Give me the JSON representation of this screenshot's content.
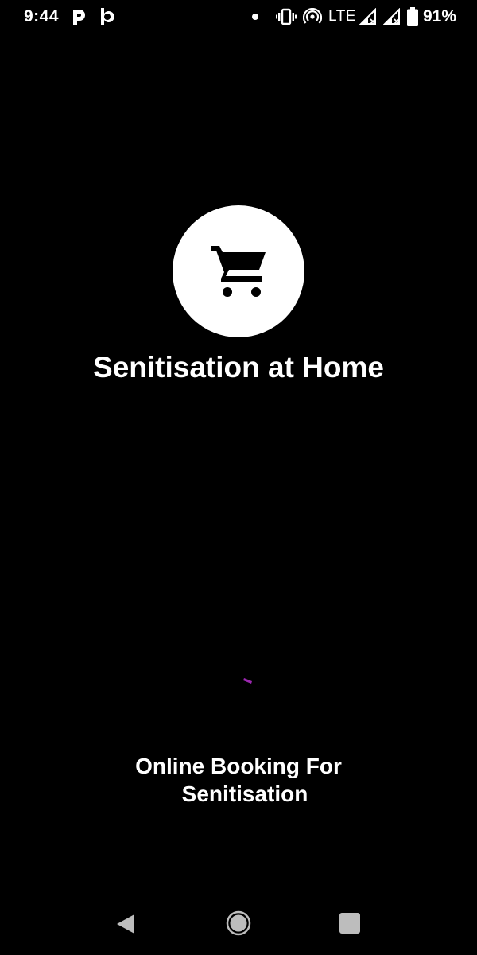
{
  "status_bar": {
    "time": "9:44",
    "left_icons": [
      "p-app-icon",
      "p-app-icon"
    ],
    "network": "LTE",
    "battery": "91%"
  },
  "app": {
    "logo_icon": "shopping-cart-icon",
    "title": "Senitisation at Home",
    "tagline_line1": "Online Booking For",
    "tagline_line2": "Senitisation"
  },
  "colors": {
    "background": "#000000",
    "logo_bg": "#ffffff",
    "spinner": "#9c27b0"
  },
  "nav_bar": {
    "buttons": [
      "back-icon",
      "home-icon",
      "recents-icon"
    ]
  }
}
